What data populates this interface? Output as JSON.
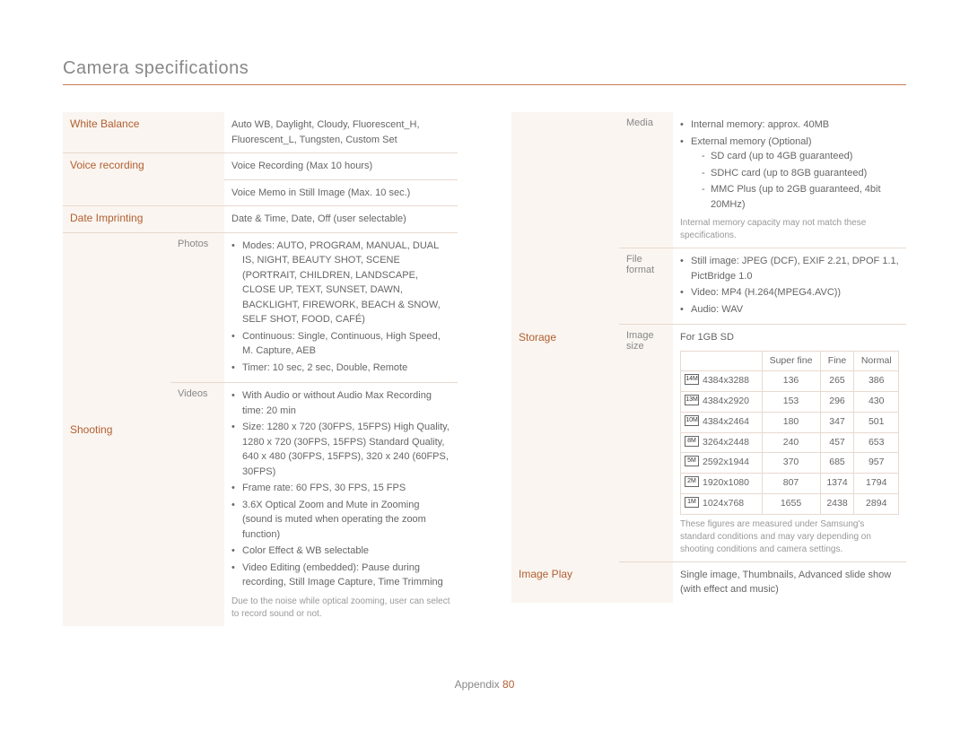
{
  "page_title": "Camera specifications",
  "footer": {
    "label": "Appendix",
    "page": "80"
  },
  "left": {
    "white_balance": {
      "label": "White Balance",
      "value": "Auto WB, Daylight, Cloudy, Fluorescent_H, Fluorescent_L, Tungsten, Custom Set"
    },
    "voice_recording": {
      "label": "Voice recording",
      "line1": "Voice Recording (Max 10 hours)",
      "line2": "Voice Memo in Still Image (Max. 10 sec.)"
    },
    "date_imprinting": {
      "label": "Date Imprinting",
      "value": "Date & Time, Date, Off (user selectable)"
    },
    "shooting": {
      "label": "Shooting",
      "photos_label": "Photos",
      "photos_bullets": [
        "Modes: AUTO, PROGRAM, MANUAL, DUAL IS, NIGHT, BEAUTY SHOT, SCENE (PORTRAIT, CHILDREN, LANDSCAPE, CLOSE UP, TEXT, SUNSET, DAWN, BACKLIGHT, FIREWORK, BEACH & SNOW, SELF SHOT, FOOD, CAFÉ)",
        "Continuous: Single, Continuous, High Speed, M. Capture, AEB",
        "Timer: 10 sec, 2 sec, Double, Remote"
      ],
      "videos_label": "Videos",
      "videos_bullets": [
        "With Audio or without Audio Max Recording time: 20 min",
        "Size: 1280 x 720 (30FPS, 15FPS) High Quality, 1280 x 720 (30FPS, 15FPS) Standard Quality, 640 x 480 (30FPS, 15FPS), 320 x 240 (60FPS, 30FPS)",
        "Frame rate: 60 FPS, 30 FPS, 15 FPS",
        "3.6X Optical Zoom and Mute in Zooming (sound is muted when operating the zoom function)",
        "Color Effect & WB selectable",
        "Video Editing (embedded): Pause during recording, Still Image Capture, Time Trimming"
      ],
      "videos_footnote": "Due to the noise while optical zooming, user can select to record sound or not."
    }
  },
  "right": {
    "storage": {
      "label": "Storage",
      "media_label": "Media",
      "media_bullets": [
        "Internal memory: approx. 40MB",
        "External memory (Optional)"
      ],
      "media_sub": [
        "SD card (up to 4GB guaranteed)",
        "SDHC card (up to 8GB guaranteed)",
        "MMC Plus (up to 2GB guaranteed, 4bit 20MHz)"
      ],
      "media_footnote": "Internal memory capacity may not match these specifications.",
      "fileformat_label": "File format",
      "fileformat_bullets": [
        "Still image: JPEG (DCF), EXIF 2.21, DPOF 1.1, PictBridge 1.0",
        "Video: MP4 (H.264(MPEG4.AVC))",
        "Audio: WAV"
      ],
      "imagesize_label": "Image size",
      "imagesize_header": "For 1GB SD",
      "table_headers": [
        "Super fine",
        "Fine",
        "Normal"
      ],
      "table_rows": [
        {
          "icon": "14M",
          "res": "4384x3288",
          "sf": "136",
          "f": "265",
          "n": "386"
        },
        {
          "icon": "13M",
          "res": "4384x2920",
          "sf": "153",
          "f": "296",
          "n": "430"
        },
        {
          "icon": "10M",
          "res": "4384x2464",
          "sf": "180",
          "f": "347",
          "n": "501"
        },
        {
          "icon": "8M",
          "res": "3264x2448",
          "sf": "240",
          "f": "457",
          "n": "653"
        },
        {
          "icon": "5M",
          "res": "2592x1944",
          "sf": "370",
          "f": "685",
          "n": "957"
        },
        {
          "icon": "2M",
          "res": "1920x1080",
          "sf": "807",
          "f": "1374",
          "n": "1794"
        },
        {
          "icon": "1M",
          "res": "1024x768",
          "sf": "1655",
          "f": "2438",
          "n": "2894"
        }
      ],
      "imagesize_footnote": "These figures are measured under Samsung's standard conditions and may vary depending on shooting conditions and camera settings."
    },
    "image_play": {
      "label": "Image Play",
      "value": "Single image, Thumbnails, Advanced slide show (with effect and music)"
    }
  }
}
